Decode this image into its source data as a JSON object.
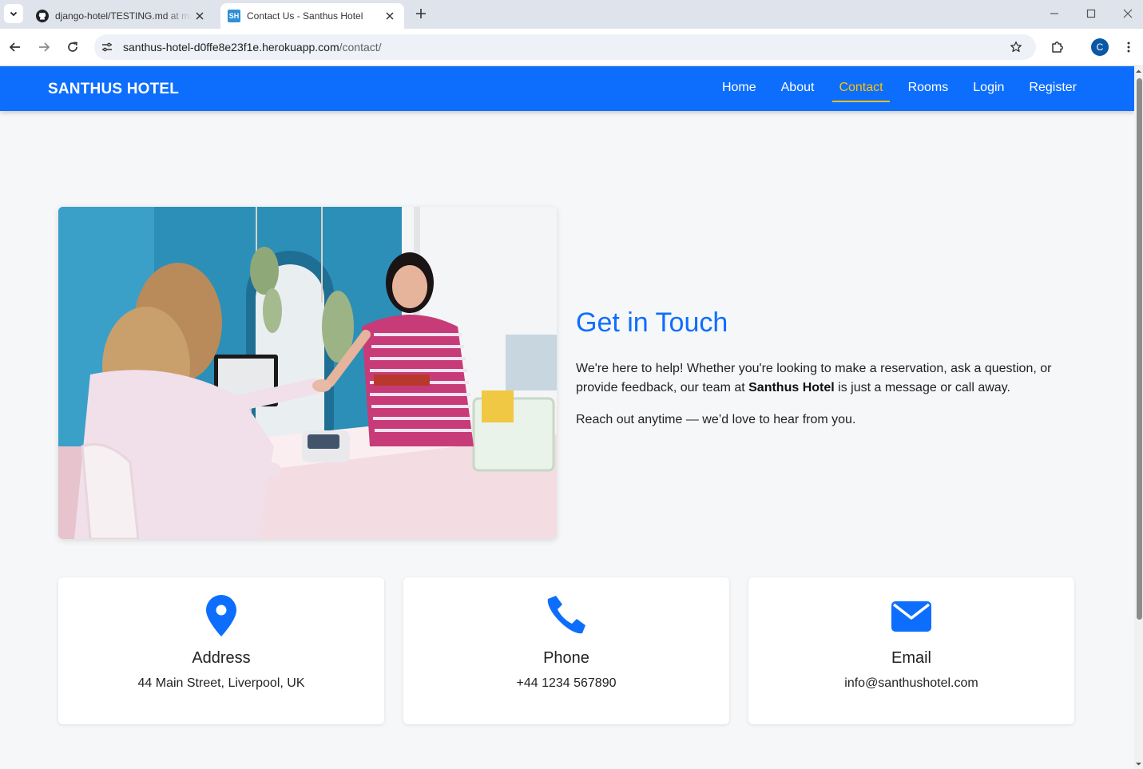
{
  "browser": {
    "tabs": [
      {
        "title": "django-hotel/TESTING.md at main",
        "active": false
      },
      {
        "title": "Contact Us - Santhus Hotel",
        "active": true,
        "favicon_text": "SH"
      }
    ],
    "url_host": "santhus-hotel-d0ffe8e23f1e.herokuapp.com",
    "url_path": "/contact/",
    "profile_initial": "C"
  },
  "navbar": {
    "brand": "SANTHUS HOTEL",
    "links": [
      {
        "label": "Home",
        "active": false
      },
      {
        "label": "About",
        "active": false
      },
      {
        "label": "Contact",
        "active": true
      },
      {
        "label": "Rooms",
        "active": false
      },
      {
        "label": "Login",
        "active": false
      },
      {
        "label": "Register",
        "active": false
      }
    ],
    "active_color": "#ffc107",
    "background": "#0d6efd"
  },
  "hero": {
    "title": "Get in Touch",
    "paragraph1_before": "We're here to help! Whether you're looking to make a reservation, ask a question, or provide feedback, our team at ",
    "paragraph1_bold": "Santhus Hotel",
    "paragraph1_after": " is just a message or call away.",
    "paragraph2": "Reach out anytime — we’d love to hear from you."
  },
  "contact_cards": [
    {
      "icon": "map-pin-icon",
      "title": "Address",
      "value": "44 Main Street, Liverpool, UK"
    },
    {
      "icon": "phone-icon",
      "title": "Phone",
      "value": "+44 1234 567890"
    },
    {
      "icon": "envelope-icon",
      "title": "Email",
      "value": "info@santhushotel.com"
    }
  ],
  "colors": {
    "accent": "#0d6efd",
    "page_bg": "#f6f7f9"
  }
}
